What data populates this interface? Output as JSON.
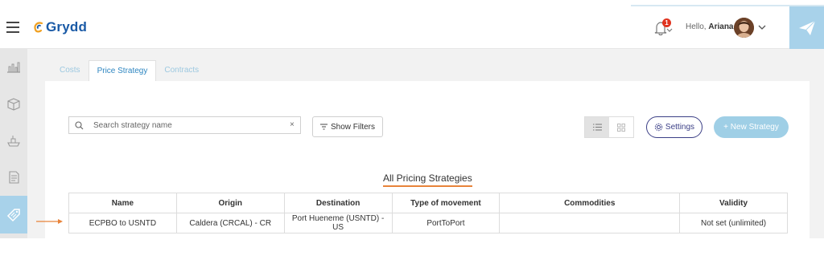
{
  "header": {
    "logo_text": "Grydd",
    "notification_count": "1",
    "greeting_prefix": "Hello,",
    "user_name": "Ariana"
  },
  "tabs": [
    {
      "label": "Costs",
      "active": false
    },
    {
      "label": "Price Strategy",
      "active": true
    },
    {
      "label": "Contracts",
      "active": false
    }
  ],
  "toolbar": {
    "search_placeholder": "Search strategy name",
    "clear_label": "×",
    "filters_label": "Show Filters",
    "settings_label": "Settings",
    "new_label": "+ New Strategy"
  },
  "table": {
    "title": "All Pricing Strategies",
    "columns": [
      "Name",
      "Origin",
      "Destination",
      "Type of movement",
      "Commodities",
      "Validity"
    ],
    "rows": [
      [
        "ECPBO to USNTD",
        "Caldera (CRCAL) - CR",
        "Port Hueneme (USNTD) - US",
        "PortToPort",
        "",
        "Not set (unlimited)"
      ]
    ]
  },
  "colors": {
    "accent": "#a8d2ea",
    "brand": "#1a5aa6",
    "highlight": "#e8833a",
    "settings": "#3b3f86"
  }
}
